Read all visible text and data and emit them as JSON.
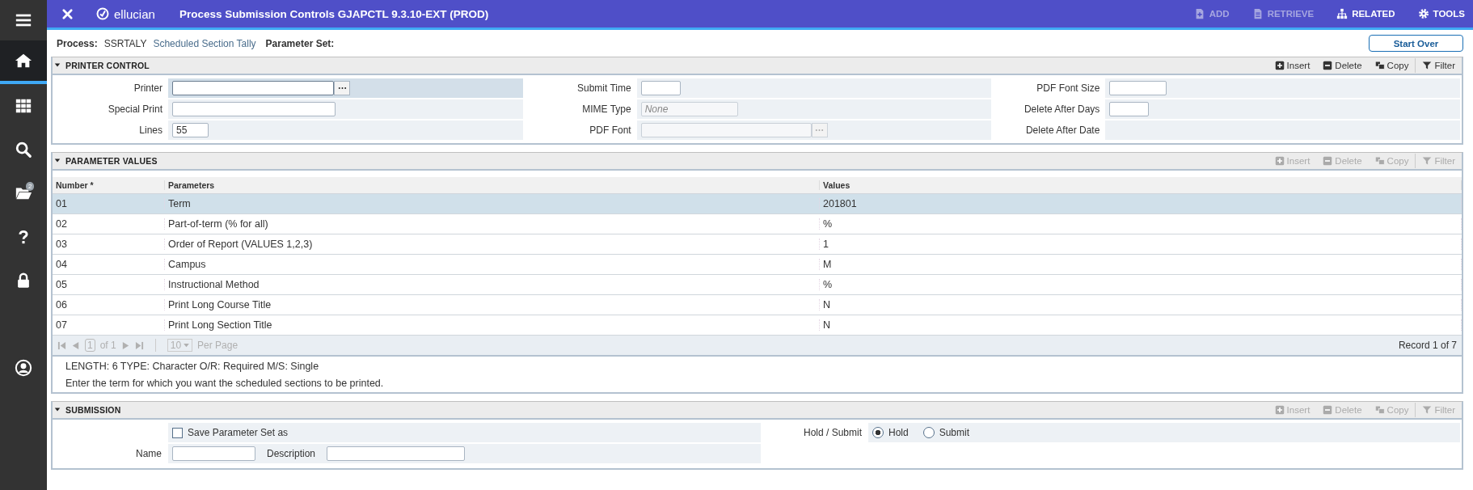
{
  "window": {
    "title": "Process Submission Controls GJAPCTL 9.3.10-EXT (PROD)",
    "logo": "ellucian"
  },
  "sidebar": {
    "items": [
      {
        "selected": false
      },
      {
        "selected": true
      },
      {
        "selected": false
      },
      {
        "selected": false
      },
      {
        "selected": false,
        "badge": "2"
      },
      {
        "selected": false
      },
      {
        "selected": false
      },
      {
        "selected": false
      }
    ]
  },
  "toolbar": [
    {
      "label": "ADD",
      "disabled": true
    },
    {
      "label": "RETRIEVE",
      "disabled": true
    },
    {
      "label": "RELATED",
      "disabled": false
    },
    {
      "label": "TOOLS",
      "disabled": false
    }
  ],
  "process": {
    "label": "Process:",
    "code": "SSRTALY",
    "name": "Scheduled Section Tally",
    "parameter_set_label": "Parameter Set:"
  },
  "start_over": "Start Over",
  "printer_control": {
    "title": "PRINTER CONTROL",
    "expanded": true,
    "actions": [
      {
        "label": "Insert",
        "disabled": false
      },
      {
        "label": "Delete",
        "disabled": false
      },
      {
        "label": "Copy",
        "disabled": false
      },
      {
        "label": "Filter",
        "disabled": false
      }
    ],
    "columns": [
      [
        {
          "label": "Printer",
          "kind": "lookup",
          "focused": true,
          "disabled": false
        },
        {
          "label": "Special Print",
          "kind": "input",
          "focused": false,
          "disabled": false
        },
        {
          "label": "Lines",
          "kind": "input",
          "value": "55",
          "focused": false,
          "disabled": false
        }
      ],
      [
        {
          "label": "Submit Time",
          "kind": "input",
          "focused": false,
          "disabled": false
        },
        {
          "label": "MIME Type",
          "kind": "input",
          "placeholder": "None",
          "focused": false,
          "disabled": true
        },
        {
          "label": "PDF Font",
          "kind": "lookup",
          "focused": false,
          "disabled": true
        }
      ],
      [
        {
          "label": "PDF Font Size",
          "kind": "input",
          "focused": false,
          "disabled": false
        },
        {
          "label": "Delete After Days",
          "kind": "input",
          "focused": false,
          "disabled": false
        },
        {
          "label": "Delete After Date",
          "kind": "plain"
        }
      ]
    ]
  },
  "parameter_values": {
    "title": "PARAMETER VALUES",
    "expanded": true,
    "actions": [
      {
        "label": "Insert",
        "disabled": true
      },
      {
        "label": "Delete",
        "disabled": true
      },
      {
        "label": "Copy",
        "disabled": true
      },
      {
        "label": "Filter",
        "disabled": true
      }
    ],
    "table": {
      "columns": [
        "Number *",
        "Parameters",
        "Values"
      ],
      "rows": [
        {
          "cells": [
            "01",
            "Term",
            "201801"
          ],
          "selected": true
        },
        {
          "cells": [
            "02",
            "Part-of-term (% for all)",
            "%"
          ],
          "selected": false
        },
        {
          "cells": [
            "03",
            "Order of Report (VALUES 1,2,3)",
            "1"
          ],
          "selected": false
        },
        {
          "cells": [
            "04",
            "Campus",
            "M"
          ],
          "selected": false
        },
        {
          "cells": [
            "05",
            "Instructional Method",
            "%"
          ],
          "selected": false
        },
        {
          "cells": [
            "06",
            "Print Long Course Title",
            "N"
          ],
          "selected": false
        },
        {
          "cells": [
            "07",
            "Print Long Section Title",
            "N"
          ],
          "selected": false
        }
      ]
    },
    "pager": {
      "page": "1",
      "of": "of 1",
      "per_page": "10",
      "per_page_label": "Per Page",
      "record": "Record 1 of 7"
    },
    "help": [
      "LENGTH: 6 TYPE: Character O/R: Required M/S: Single",
      "Enter the term for which you want the scheduled sections to be printed."
    ]
  },
  "submission": {
    "title": "SUBMISSION",
    "expanded": true,
    "actions": [
      {
        "label": "Insert",
        "disabled": true
      },
      {
        "label": "Delete",
        "disabled": true
      },
      {
        "label": "Copy",
        "disabled": true
      },
      {
        "label": "Filter",
        "disabled": true
      }
    ],
    "save": {
      "label": "Save Parameter Set as",
      "checked": false
    },
    "name_label": "Name",
    "description_label": "Description",
    "hold_submit_label": "Hold / Submit",
    "options": [
      {
        "label": "Hold",
        "selected": true
      },
      {
        "label": "Submit",
        "selected": false
      }
    ]
  }
}
